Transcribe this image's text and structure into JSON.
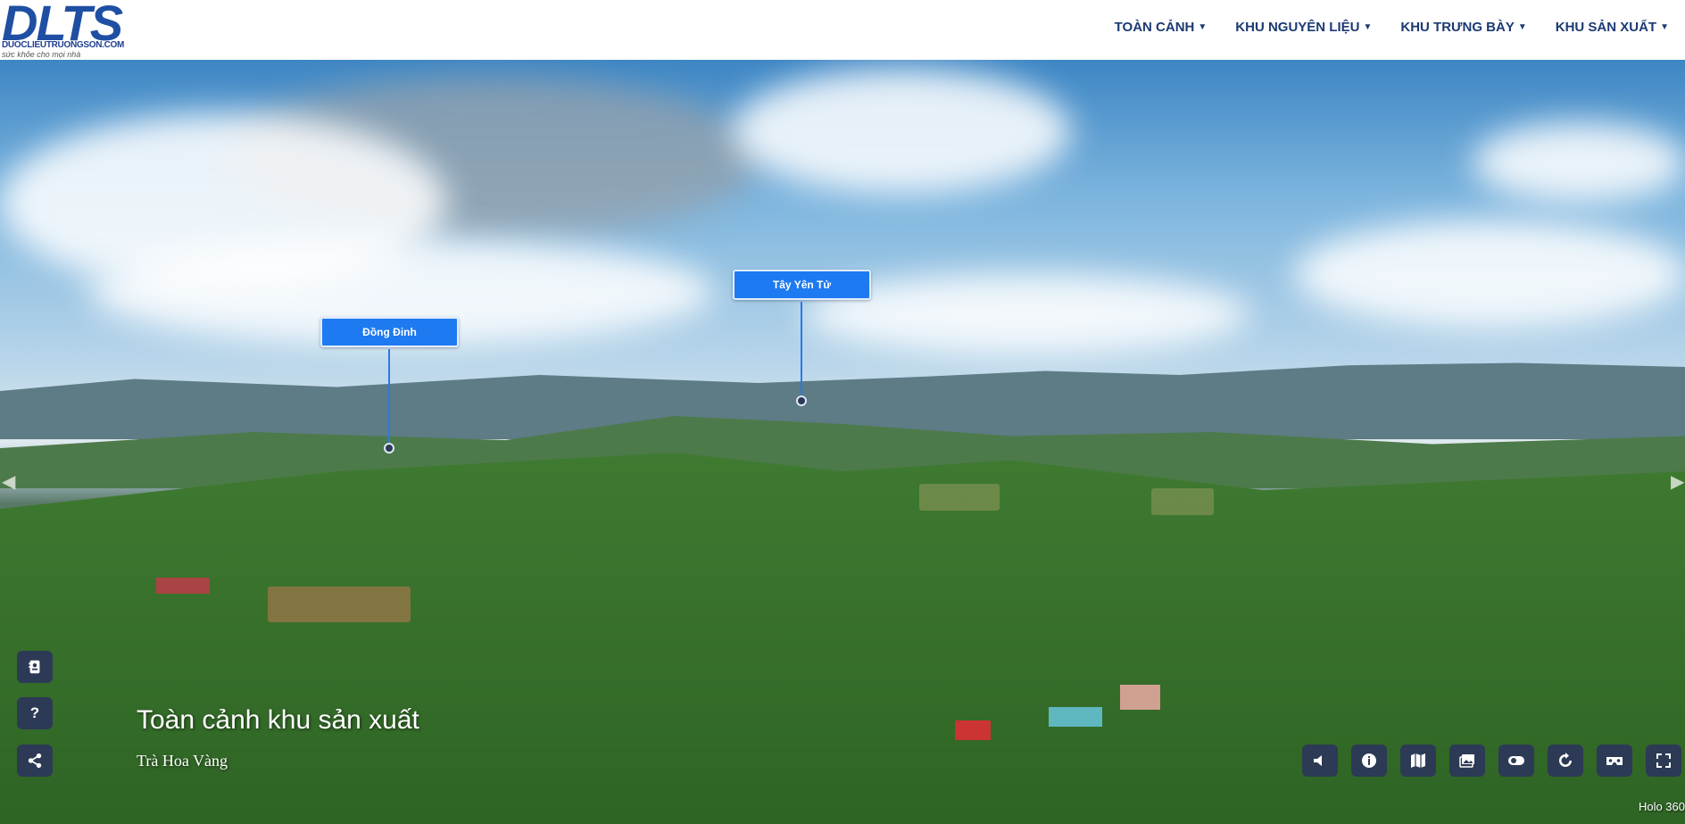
{
  "brand": {
    "logo_text": "DLTS",
    "site": "DUOCLIEUTRUONGSON.COM",
    "tagline": "sức khỏe cho mọi nhà"
  },
  "nav": {
    "items": [
      {
        "label": "TOÀN CẢNH"
      },
      {
        "label": "KHU NGUYÊN LIỆU"
      },
      {
        "label": "KHU TRƯNG BÀY"
      },
      {
        "label": "KHU SẢN XUẤT"
      }
    ]
  },
  "hotspots": [
    {
      "label": "Đồng Đinh"
    },
    {
      "label": "Tây Yên Tử"
    }
  ],
  "scene": {
    "title": "Toàn cảnh khu sản xuất",
    "subtitle": "Trà Hoa Vàng"
  },
  "left_buttons": [
    {
      "icon": "contact-card-icon"
    },
    {
      "icon": "help-icon",
      "glyph": "?"
    },
    {
      "icon": "share-icon"
    }
  ],
  "controls": [
    {
      "icon": "sound-icon"
    },
    {
      "icon": "info-icon"
    },
    {
      "icon": "map-icon"
    },
    {
      "icon": "gallery-icon"
    },
    {
      "icon": "toggle-icon"
    },
    {
      "icon": "autorotate-icon"
    },
    {
      "icon": "vr-icon"
    },
    {
      "icon": "fullscreen-icon"
    }
  ],
  "credit": "Holo 360",
  "colors": {
    "nav_text": "#1c3a73",
    "hotspot": "#1e7af0",
    "button_bg": "#2c3a55"
  }
}
